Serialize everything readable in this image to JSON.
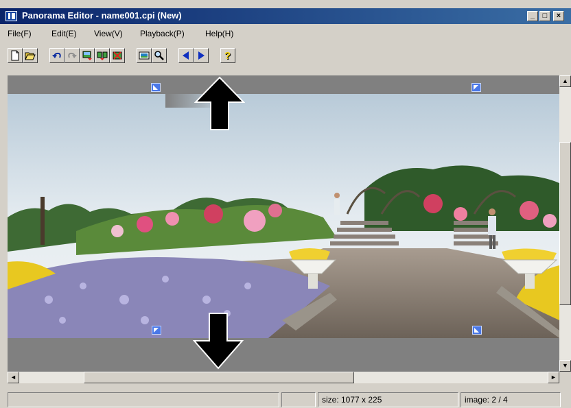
{
  "window": {
    "title": "Panorama Editor - name001.cpi (New)",
    "minimize_label": "_",
    "maximize_label": "□",
    "close_label": "×"
  },
  "menu": {
    "items": [
      {
        "label": "File(F)"
      },
      {
        "label": "Edit(E)"
      },
      {
        "label": "View(V)"
      },
      {
        "label": "Playback(P)"
      },
      {
        "label": "Help(H)"
      }
    ]
  },
  "toolbar": {
    "buttons": [
      "new-file-icon",
      "open-folder-icon",
      "undo-icon",
      "redo-icon",
      "insert-image-icon",
      "split-image-icon",
      "delete-image-icon",
      "fit-view-icon",
      "zoom-icon",
      "previous-icon",
      "next-icon",
      "help-icon"
    ]
  },
  "canvas": {
    "image_description_free": true
  },
  "scrollbars": {
    "up": "▲",
    "down": "▼",
    "left": "◄",
    "right": "►"
  },
  "status": {
    "main": "",
    "empty": "",
    "size": "size: 1077 x 225",
    "image": "image: 2 / 4"
  },
  "colors": {
    "titlebar_start": "#0a246a",
    "titlebar_end": "#3a6ea5",
    "face": "#d4d0c8",
    "canvas_bg": "#808080",
    "marker": "#4a78e8"
  }
}
